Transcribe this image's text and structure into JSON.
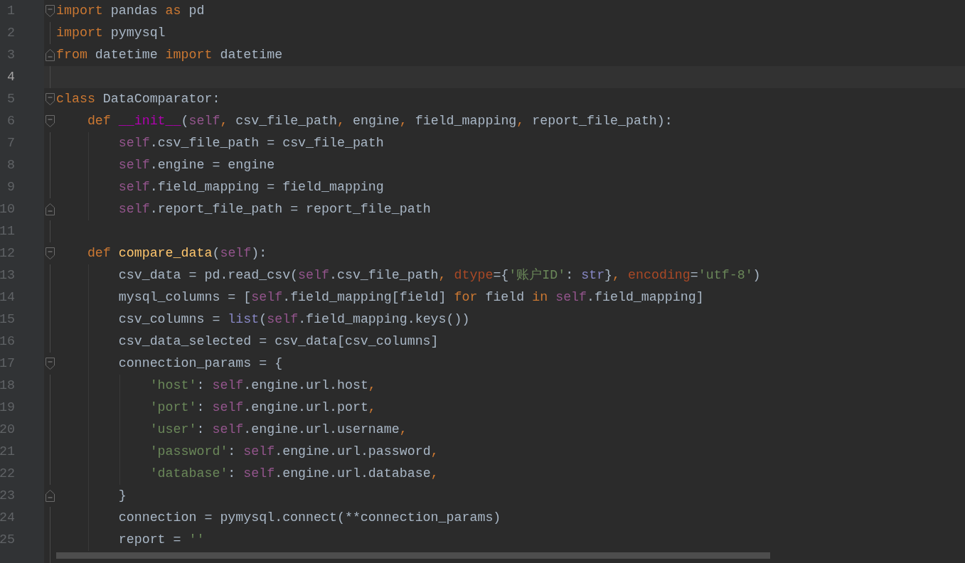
{
  "editor": {
    "lines": [
      {
        "number": "1",
        "current": false,
        "fold": {
          "kind": "start"
        },
        "tokens": [
          {
            "text": "import",
            "kind": "kw"
          },
          {
            "text": " pandas ",
            "kind": "id"
          },
          {
            "text": "as",
            "kind": "kw"
          },
          {
            "text": " pd",
            "kind": "id"
          }
        ]
      },
      {
        "number": "2",
        "current": false,
        "tokens": [
          {
            "text": "import",
            "kind": "kw"
          },
          {
            "text": " pymysql",
            "kind": "id"
          }
        ]
      },
      {
        "number": "3",
        "current": false,
        "fold": {
          "kind": "end"
        },
        "tokens": [
          {
            "text": "from",
            "kind": "kw"
          },
          {
            "text": " datetime ",
            "kind": "id"
          },
          {
            "text": "import",
            "kind": "kw"
          },
          {
            "text": " datetime",
            "kind": "id"
          }
        ]
      },
      {
        "number": "4",
        "current": true
      },
      {
        "number": "5",
        "current": false,
        "fold": {
          "kind": "start"
        },
        "tokens": [
          {
            "text": "class",
            "kind": "kw"
          },
          {
            "text": " DataComparator:",
            "kind": "id"
          }
        ]
      },
      {
        "number": "6",
        "current": false,
        "fold": {
          "kind": "start"
        },
        "tokens": [
          {
            "text": "    def ",
            "kind": "kw"
          },
          {
            "text": "__init__",
            "kind": "magic"
          },
          {
            "text": "(",
            "kind": "id"
          },
          {
            "text": "self",
            "kind": "self"
          },
          {
            "text": ",",
            "kind": "kw"
          },
          {
            "text": " csv_file_path",
            "kind": "id"
          },
          {
            "text": ",",
            "kind": "kw"
          },
          {
            "text": " engine",
            "kind": "id"
          },
          {
            "text": ",",
            "kind": "kw"
          },
          {
            "text": " field_mapping",
            "kind": "id"
          },
          {
            "text": ",",
            "kind": "kw"
          },
          {
            "text": " report_file_path):",
            "kind": "id"
          }
        ]
      },
      {
        "number": "7",
        "current": false,
        "tokens": [
          {
            "text": "        self",
            "kind": "self"
          },
          {
            "text": ".csv_file_path = csv_file_path",
            "kind": "id"
          }
        ]
      },
      {
        "number": "8",
        "current": false,
        "tokens": [
          {
            "text": "        self",
            "kind": "self"
          },
          {
            "text": ".engine = engine",
            "kind": "id"
          }
        ]
      },
      {
        "number": "9",
        "current": false,
        "tokens": [
          {
            "text": "        self",
            "kind": "self"
          },
          {
            "text": ".field_mapping = field_mapping",
            "kind": "id"
          }
        ]
      },
      {
        "number": "10",
        "current": false,
        "fold": {
          "kind": "end"
        },
        "tokens": [
          {
            "text": "        self",
            "kind": "self"
          },
          {
            "text": ".report_file_path = report_file_path",
            "kind": "id"
          }
        ]
      },
      {
        "number": "11",
        "current": false
      },
      {
        "number": "12",
        "current": false,
        "fold": {
          "kind": "start"
        },
        "tokens": [
          {
            "text": "    def ",
            "kind": "kw"
          },
          {
            "text": "compare_data",
            "kind": "fn"
          },
          {
            "text": "(",
            "kind": "id"
          },
          {
            "text": "self",
            "kind": "self"
          },
          {
            "text": "):",
            "kind": "id"
          }
        ]
      },
      {
        "number": "13",
        "current": false,
        "tokens": [
          {
            "text": "        csv_data = pd.read_csv(",
            "kind": "id"
          },
          {
            "text": "self",
            "kind": "self"
          },
          {
            "text": ".csv_file_path",
            "kind": "id"
          },
          {
            "text": ",",
            "kind": "kw"
          },
          {
            "text": " dtype",
            "kind": "kwarg"
          },
          {
            "text": "={",
            "kind": "id"
          },
          {
            "text": "'账户ID'",
            "kind": "str"
          },
          {
            "text": ": ",
            "kind": "id"
          },
          {
            "text": "str",
            "kind": "builtin"
          },
          {
            "text": "}",
            "kind": "id"
          },
          {
            "text": ",",
            "kind": "kw"
          },
          {
            "text": " encoding",
            "kind": "kwarg"
          },
          {
            "text": "=",
            "kind": "id"
          },
          {
            "text": "'utf-8'",
            "kind": "str"
          },
          {
            "text": ")",
            "kind": "id"
          }
        ]
      },
      {
        "number": "14",
        "current": false,
        "tokens": [
          {
            "text": "        mysql_columns = [",
            "kind": "id"
          },
          {
            "text": "self",
            "kind": "self"
          },
          {
            "text": ".field_mapping[field] ",
            "kind": "id"
          },
          {
            "text": "for",
            "kind": "kw"
          },
          {
            "text": " field ",
            "kind": "id"
          },
          {
            "text": "in ",
            "kind": "kw"
          },
          {
            "text": "self",
            "kind": "self"
          },
          {
            "text": ".field_mapping]",
            "kind": "id"
          }
        ]
      },
      {
        "number": "15",
        "current": false,
        "tokens": [
          {
            "text": "        csv_columns = ",
            "kind": "id"
          },
          {
            "text": "list",
            "kind": "builtin"
          },
          {
            "text": "(",
            "kind": "id"
          },
          {
            "text": "self",
            "kind": "self"
          },
          {
            "text": ".field_mapping.keys())",
            "kind": "id"
          }
        ]
      },
      {
        "number": "16",
        "current": false,
        "tokens": [
          {
            "text": "        csv_data_selected = csv_data[csv_columns]",
            "kind": "id"
          }
        ]
      },
      {
        "number": "17",
        "current": false,
        "fold": {
          "kind": "start"
        },
        "tokens": [
          {
            "text": "        connection_params = {",
            "kind": "id"
          }
        ]
      },
      {
        "number": "18",
        "current": false,
        "tokens": [
          {
            "text": "            'host'",
            "kind": "str"
          },
          {
            "text": ": ",
            "kind": "id"
          },
          {
            "text": "self",
            "kind": "self"
          },
          {
            "text": ".engine.url.host",
            "kind": "id"
          },
          {
            "text": ",",
            "kind": "kw"
          }
        ]
      },
      {
        "number": "19",
        "current": false,
        "tokens": [
          {
            "text": "            'port'",
            "kind": "str"
          },
          {
            "text": ": ",
            "kind": "id"
          },
          {
            "text": "self",
            "kind": "self"
          },
          {
            "text": ".engine.url.port",
            "kind": "id"
          },
          {
            "text": ",",
            "kind": "kw"
          }
        ]
      },
      {
        "number": "20",
        "current": false,
        "tokens": [
          {
            "text": "            'user'",
            "kind": "str"
          },
          {
            "text": ": ",
            "kind": "id"
          },
          {
            "text": "self",
            "kind": "self"
          },
          {
            "text": ".engine.url.username",
            "kind": "id"
          },
          {
            "text": ",",
            "kind": "kw"
          }
        ]
      },
      {
        "number": "21",
        "current": false,
        "tokens": [
          {
            "text": "            'password'",
            "kind": "str"
          },
          {
            "text": ": ",
            "kind": "id"
          },
          {
            "text": "self",
            "kind": "self"
          },
          {
            "text": ".engine.url.password",
            "kind": "id"
          },
          {
            "text": ",",
            "kind": "kw"
          }
        ]
      },
      {
        "number": "22",
        "current": false,
        "tokens": [
          {
            "text": "            'database'",
            "kind": "str"
          },
          {
            "text": ": ",
            "kind": "id"
          },
          {
            "text": "self",
            "kind": "self"
          },
          {
            "text": ".engine.url.database",
            "kind": "id"
          },
          {
            "text": ",",
            "kind": "kw"
          }
        ]
      },
      {
        "number": "23",
        "current": false,
        "fold": {
          "kind": "end"
        },
        "tokens": [
          {
            "text": "        }",
            "kind": "id"
          }
        ]
      },
      {
        "number": "24",
        "current": false,
        "tokens": [
          {
            "text": "        connection = pymysql.connect(**connection_params)",
            "kind": "id"
          }
        ]
      },
      {
        "number": "25",
        "current": false,
        "tokens": [
          {
            "text": "        report = ",
            "kind": "id"
          },
          {
            "text": "''",
            "kind": "str"
          }
        ]
      }
    ]
  }
}
